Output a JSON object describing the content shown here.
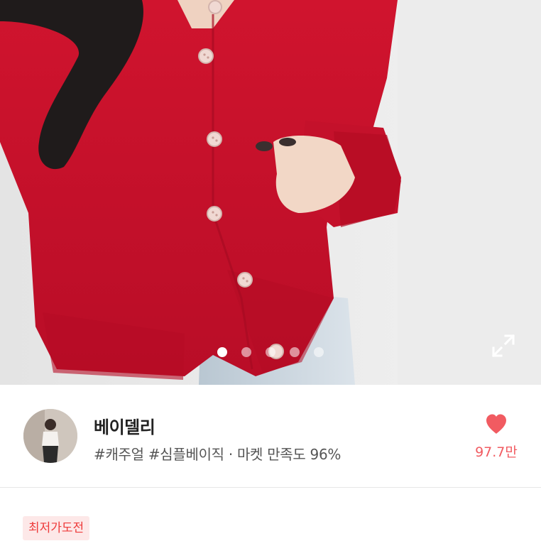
{
  "product_image": {
    "current_index": 1,
    "total": 5,
    "alt_subject": "red-knit-cardigan"
  },
  "store": {
    "name": "베이델리",
    "meta": "#캐주얼 #심플베이직 · 마켓 만족도 96%",
    "like_count": "97.7만",
    "like_color": "#f15b61"
  },
  "badge": {
    "label": "최저가도전",
    "color": "#ee3b3b",
    "bg": "#fde8e8"
  },
  "icons": {
    "expand": "expand-icon",
    "heart": "heart-icon"
  },
  "colors": {
    "cardigan": "#c8102e",
    "background": "#ffffff"
  }
}
